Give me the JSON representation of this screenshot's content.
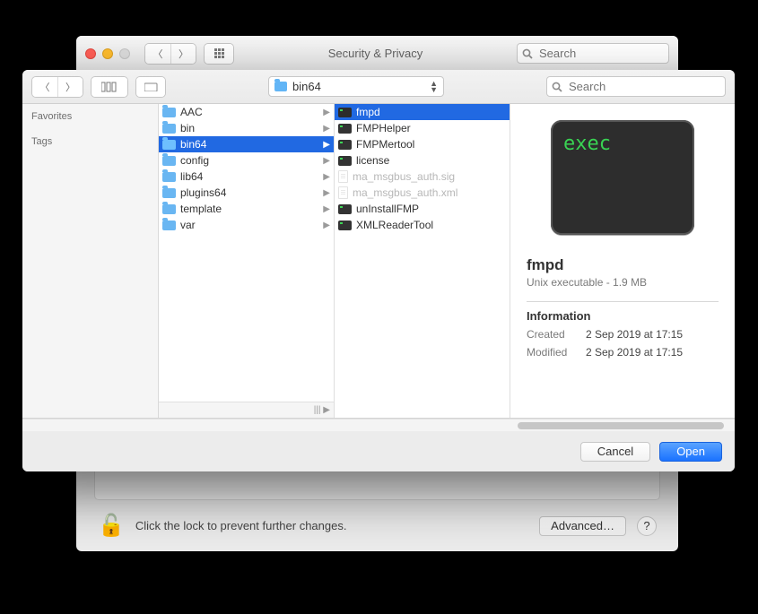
{
  "back_window": {
    "title": "Security & Privacy",
    "search_placeholder": "Search",
    "lock_text": "Click the lock to prevent further changes.",
    "advanced": "Advanced…",
    "help": "?"
  },
  "dialog": {
    "search_placeholder": "Search",
    "location_label": "bin64",
    "sidebar": {
      "favorites": "Favorites",
      "tags": "Tags"
    },
    "col1": [
      {
        "name": "AAC",
        "type": "folder"
      },
      {
        "name": "bin",
        "type": "folder"
      },
      {
        "name": "bin64",
        "type": "folder",
        "selected": true
      },
      {
        "name": "config",
        "type": "folder"
      },
      {
        "name": "lib64",
        "type": "folder"
      },
      {
        "name": "plugins64",
        "type": "folder"
      },
      {
        "name": "template",
        "type": "folder"
      },
      {
        "name": "var",
        "type": "folder"
      }
    ],
    "col2": [
      {
        "name": "fmpd",
        "type": "exec",
        "selected": true
      },
      {
        "name": "FMPHelper",
        "type": "exec"
      },
      {
        "name": "FMPMertool",
        "type": "exec"
      },
      {
        "name": "license",
        "type": "exec"
      },
      {
        "name": "ma_msgbus_auth.sig",
        "type": "doc",
        "dim": true
      },
      {
        "name": "ma_msgbus_auth.xml",
        "type": "doc",
        "dim": true
      },
      {
        "name": "unInstallFMP",
        "type": "exec"
      },
      {
        "name": "XMLReaderTool",
        "type": "exec"
      }
    ],
    "preview": {
      "thumb_text": "exec",
      "name": "fmpd",
      "subtitle": "Unix executable - 1.9 MB",
      "section": "Information",
      "created_label": "Created",
      "created_value": "2 Sep 2019 at 17:15",
      "modified_label": "Modified",
      "modified_value": "2 Sep 2019 at 17:15"
    },
    "buttons": {
      "cancel": "Cancel",
      "open": "Open"
    }
  }
}
